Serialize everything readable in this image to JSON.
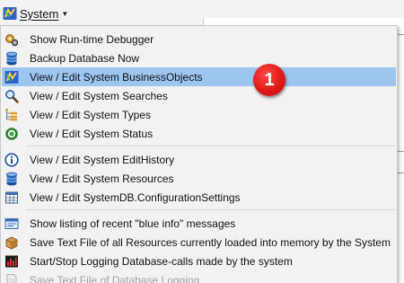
{
  "menubar": {
    "label": "System",
    "icon": "business-objects-icon"
  },
  "menu": {
    "items": [
      {
        "label": "Show Run-time Debugger",
        "icon": "debugger-gears-icon"
      },
      {
        "label": "Backup Database Now",
        "icon": "database-icon"
      },
      {
        "label": "View / Edit System BusinessObjects",
        "icon": "business-objects-icon",
        "highlighted": true
      },
      {
        "label": "View / Edit System Searches",
        "icon": "magnifier-icon"
      },
      {
        "label": "View / Edit System Types",
        "icon": "tree-icon"
      },
      {
        "label": "View / Edit System Status",
        "icon": "status-circle-icon"
      },
      {
        "label": "View / Edit System EditHistory",
        "icon": "info-icon"
      },
      {
        "label": "View / Edit System Resources",
        "icon": "database-icon"
      },
      {
        "label": "View / Edit SystemDB.ConfigurationSettings",
        "icon": "grid-icon"
      },
      {
        "label": "Show listing of recent \"blue info\" messages",
        "icon": "info-window-icon"
      },
      {
        "label": "Save Text File of all Resources currently loaded into memory by the System",
        "icon": "package-icon"
      },
      {
        "label": "Start/Stop Logging Database-calls made by the system",
        "icon": "bar-chart-icon"
      },
      {
        "label": "Save Text File of Database Logging",
        "icon": "document-icon",
        "disabled": true
      }
    ]
  },
  "badge": {
    "text": "1",
    "color": "#e01818"
  },
  "colors": {
    "highlight": "#9cc6f0",
    "menu_background": "#f2f2f2"
  }
}
